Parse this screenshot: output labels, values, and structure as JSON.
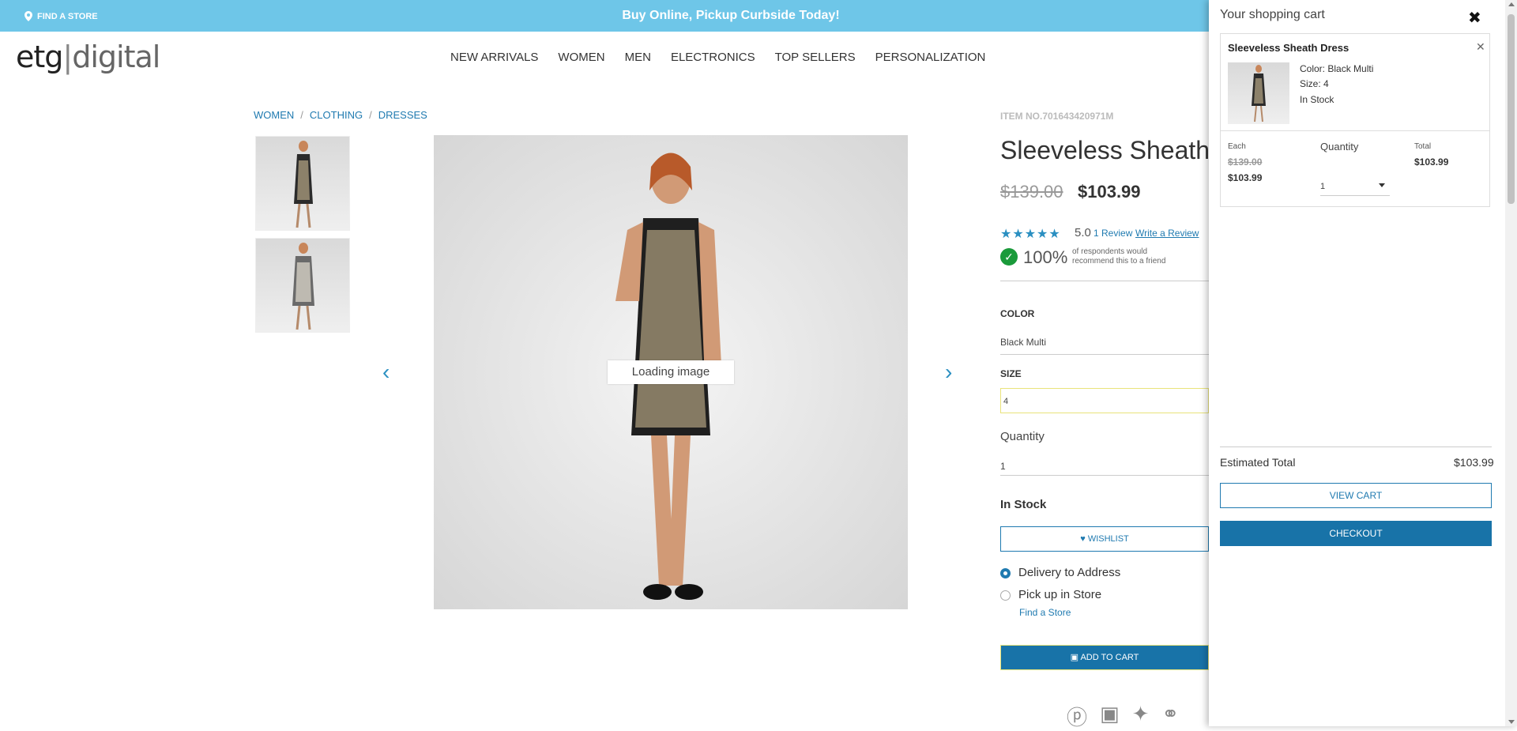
{
  "topbar": {
    "find_store": "FIND A STORE",
    "promo": "Buy Online, Pickup Curbside Today!"
  },
  "logo": {
    "part1": "etg",
    "part2": "digital"
  },
  "nav": [
    "NEW ARRIVALS",
    "WOMEN",
    "MEN",
    "ELECTRONICS",
    "TOP SELLERS",
    "PERSONALIZATION"
  ],
  "breadcrumb": [
    "WOMEN",
    "CLOTHING",
    "DRESSES"
  ],
  "gallery": {
    "loading": "Loading image"
  },
  "product": {
    "item_no": "ITEM NO.701643420971M",
    "title": "Sleeveless Sheath Dress",
    "old_price": "$139.00",
    "price": "$103.99",
    "rating": "5.0",
    "review_count": "1 Review",
    "write_review": "Write a Review",
    "recommend_pct": "100%",
    "recommend_text": "of respondents would recommend this to a friend",
    "color_label": "COLOR",
    "color_value": "Black Multi",
    "size_label": "SIZE",
    "size_value": "4",
    "qty_label": "Quantity",
    "qty_value": "1",
    "stock": "In Stock",
    "wishlist": "WISHLIST",
    "delivery": "Delivery to Address",
    "pickup": "Pick up in Store",
    "find_store": "Find a Store",
    "add_to_cart": "ADD TO CART"
  },
  "cart": {
    "title": "Your shopping cart",
    "item": {
      "name": "Sleeveless Sheath Dress",
      "color": "Color: Black Multi",
      "size": "Size: 4",
      "stock": "In Stock",
      "each_label": "Each",
      "each_old": "$139.00",
      "each_price": "$103.99",
      "qty_label": "Quantity",
      "qty": "1",
      "total_label": "Total",
      "total": "$103.99"
    },
    "est_label": "Estimated Total",
    "est_value": "$103.99",
    "view_cart": "VIEW CART",
    "checkout": "CHECKOUT"
  }
}
